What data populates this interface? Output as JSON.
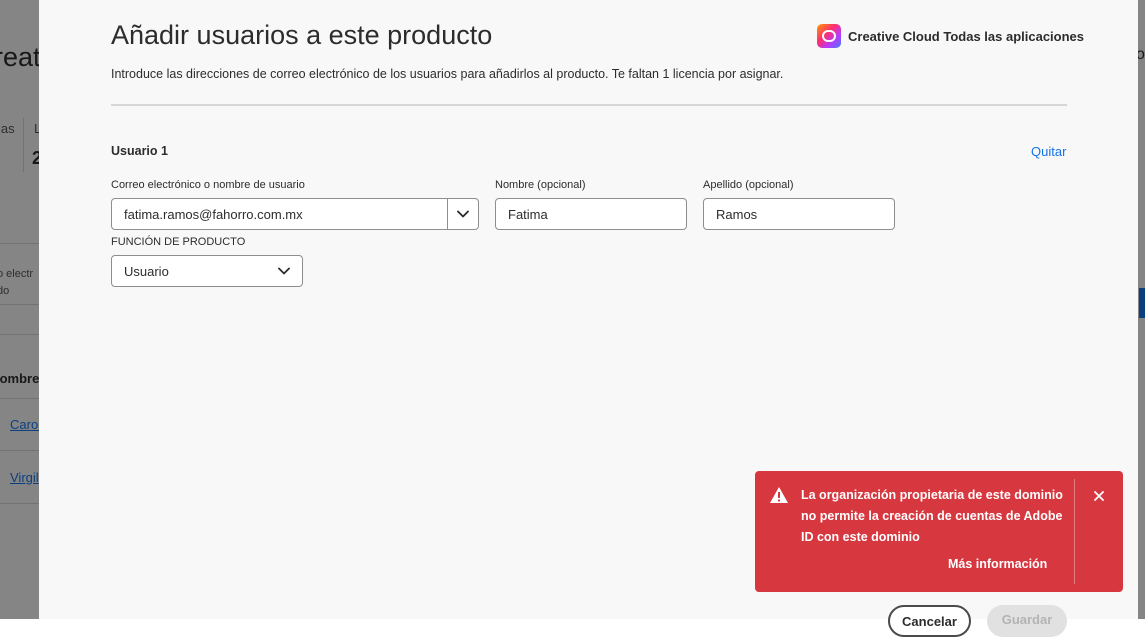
{
  "background": {
    "title_fragment": "reat",
    "col_a": "ias",
    "col_b": "L",
    "number_fragment": "2",
    "email_fragment_1": "o electr",
    "email_fragment_2": "do",
    "name_header_fragment": "lombre",
    "rows": [
      "Carol",
      "Virgil"
    ],
    "right_fragment": "o"
  },
  "modal": {
    "title": "Añadir usuarios a este producto",
    "product_name": "Creative Cloud Todas las aplicaciones",
    "product_icon": "creative-cloud-icon",
    "subtitle": "Introduce las direcciones de correo electrónico de los usuarios para añadirlos al producto. Te faltan 1 licencia por asignar.",
    "user_block": {
      "label": "Usuario 1",
      "remove_label": "Quitar",
      "email_label": "Correo electrónico o nombre de usuario",
      "email_value": "fatima.ramos@fahorro.com.mx",
      "first_name_label": "Nombre (opcional)",
      "first_name_value": "Fatima",
      "last_name_label": "Apellido (opcional)",
      "last_name_value": "Ramos",
      "role_label": "FUNCIÓN DE PRODUCTO",
      "role_value": "Usuario"
    },
    "buttons": {
      "cancel": "Cancelar",
      "save": "Guardar"
    }
  },
  "toast": {
    "message": "La organización propietaria de este dominio no permite la creación de cuentas de Adobe ID con este dominio",
    "action": "Más información",
    "color": "#d7373f",
    "icon": "alert-icon"
  },
  "colors": {
    "link": "#1473e6",
    "error": "#d7373f"
  }
}
